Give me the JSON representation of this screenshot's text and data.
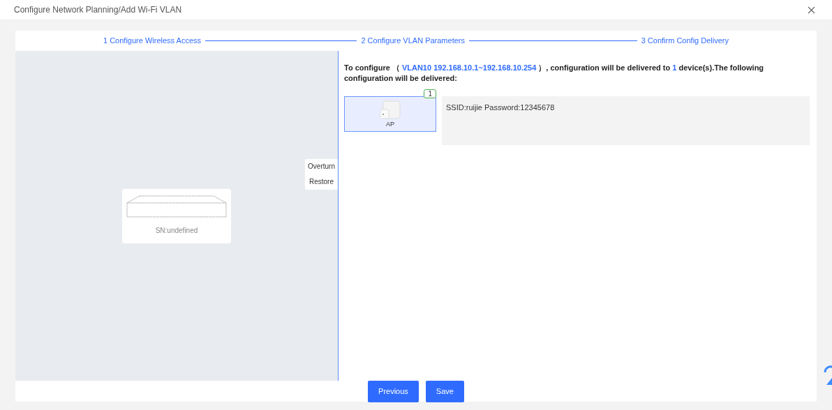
{
  "window": {
    "title": "Configure Network Planning/Add Wi-Fi VLAN"
  },
  "steps": [
    {
      "label": "1 Configure Wireless Access"
    },
    {
      "label": "2 Configure VLAN Parameters"
    },
    {
      "label": "3 Confirm Config Delivery"
    }
  ],
  "canvas": {
    "actions": [
      "Overturn",
      "Restore"
    ],
    "device": {
      "label": "SN:undefined"
    }
  },
  "summary": [
    {
      "text": "To configure （",
      "highlight": false
    },
    {
      "text": "VLAN10 192.168.10.1~192.168.10.254",
      "highlight": true
    },
    {
      "text": "）, configuration will be delivered to",
      "highlight": false
    },
    {
      "text": "1",
      "highlight": true
    },
    {
      "text": "device(s).The following configuration will be delivered:",
      "highlight": false
    }
  ],
  "devices": [
    {
      "label": "AP",
      "count": "1",
      "selected": true,
      "config": "SSID:ruijie Password:12345678"
    }
  ],
  "buttons": [
    "Previous",
    "Save"
  ]
}
